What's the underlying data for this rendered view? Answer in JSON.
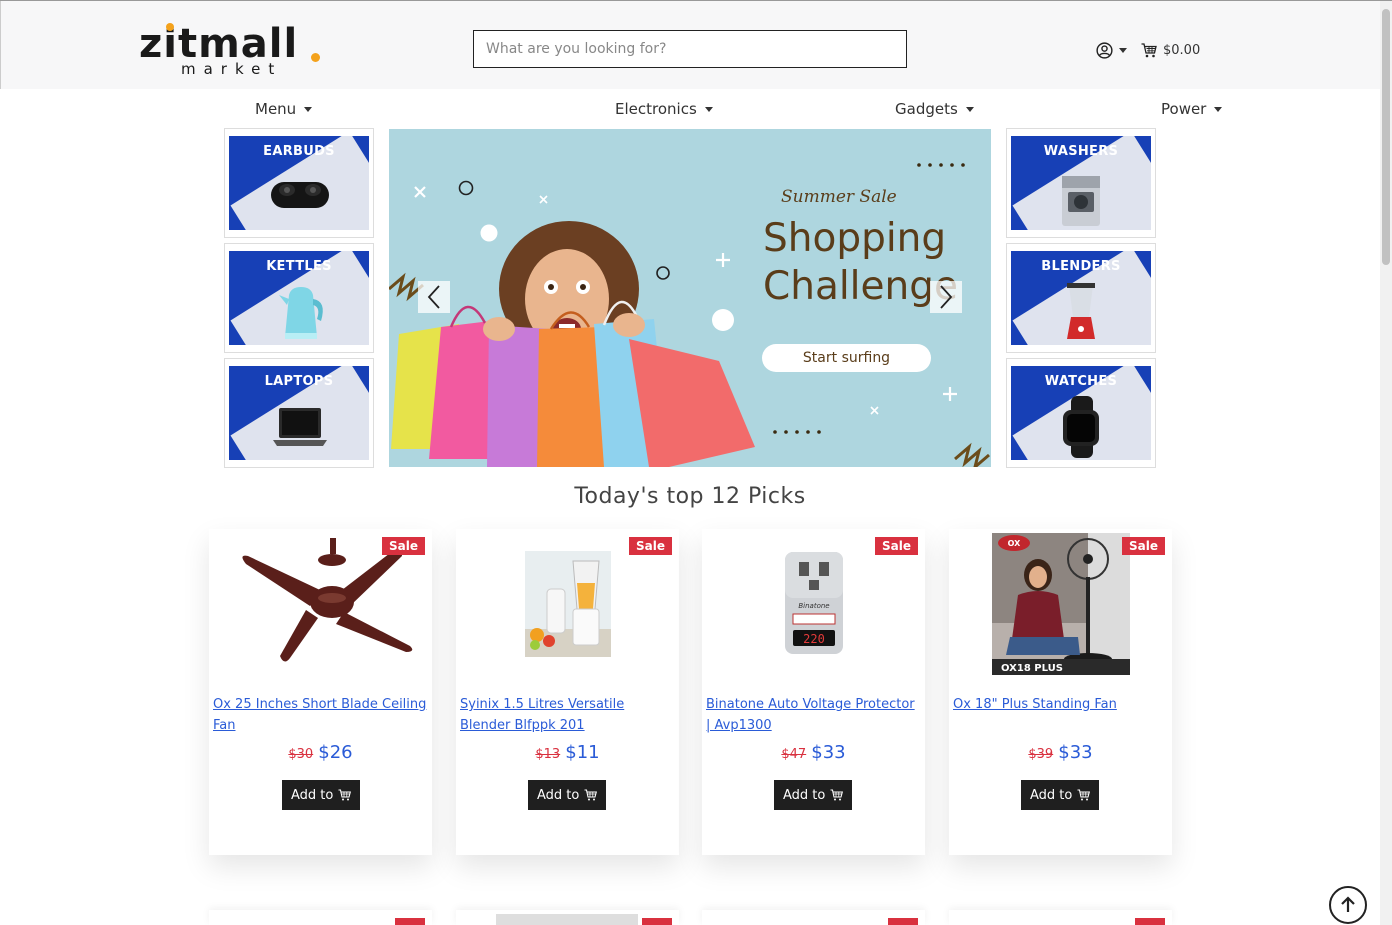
{
  "brand": {
    "name": "zitmall",
    "tagline": "market",
    "accent": "#f4a21c"
  },
  "search": {
    "placeholder": "What are you looking for?"
  },
  "account": {
    "icon": "user-circle-icon"
  },
  "cart": {
    "total": "$0.00",
    "icon": "cart-icon"
  },
  "nav": [
    "Menu",
    "Electronics",
    "Gadgets",
    "Power"
  ],
  "categories_left": [
    "EARBUDS",
    "KETTLES",
    "LAPTOPS"
  ],
  "categories_right": [
    "WASHERS",
    "BLENDERS",
    "WATCHES"
  ],
  "banner": {
    "sale_text": "Summer Sale",
    "title_line1": "Shopping",
    "title_line2": "Challenge",
    "cta": "Start surfing"
  },
  "section_title": "Today's top 12 Picks",
  "products": [
    {
      "name": "Ox 25 Inches Short Blade Ceiling Fan",
      "old_price": "$30",
      "price": "$26",
      "badge": "Sale",
      "button": "Add to"
    },
    {
      "name": "Syinix 1.5 Litres Versatile Blender Blfppk 201",
      "old_price": "$13",
      "price": "$11",
      "badge": "Sale",
      "button": "Add to"
    },
    {
      "name": "Binatone Auto Voltage Protector | Avp1300",
      "old_price": "$47",
      "price": "$33",
      "badge": "Sale",
      "button": "Add to"
    },
    {
      "name": "Ox 18\" Plus Standing Fan",
      "old_price": "$39",
      "price": "$33",
      "badge": "Sale",
      "button": "Add to"
    }
  ],
  "product_images": {
    "voltage_display": "220",
    "voltage_brand": "Binatone",
    "fan_brand": "OX",
    "fan_model": "OX18 PLUS"
  },
  "colors": {
    "sale": "#d9313f",
    "price": "#2a5bd7",
    "tile_blue": "#1740b6",
    "banner_bg": "#aed6df",
    "banner_text": "#5a3d1a"
  }
}
